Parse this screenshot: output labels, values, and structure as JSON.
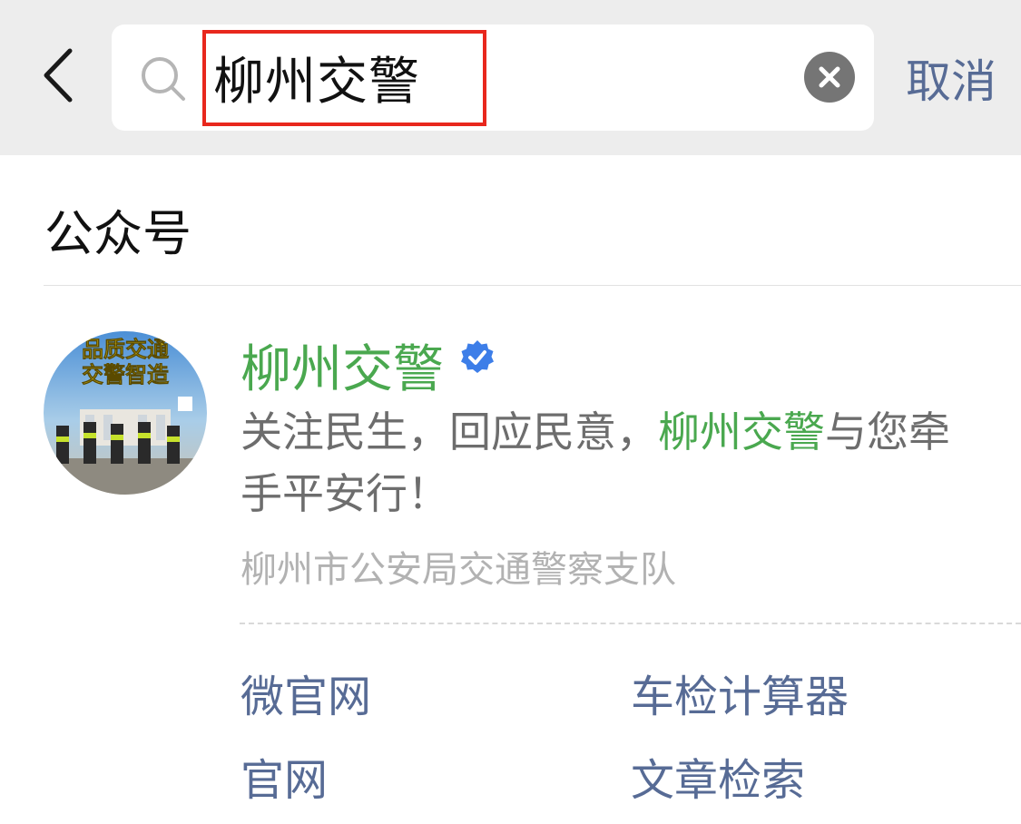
{
  "search": {
    "query": "柳州交警",
    "cancel_label": "取消"
  },
  "section": {
    "title": "公众号"
  },
  "account": {
    "name": "柳州交警",
    "verified": true,
    "description_before": "关注民生，回应民意，",
    "description_highlight": "柳州交警",
    "description_after": "与您牵手平安行！",
    "organization": "柳州市公安局交通警察支队",
    "avatar_text_line1": "品质交通",
    "avatar_text_line2": "交警智造"
  },
  "menu": {
    "items": [
      {
        "label": "微官网"
      },
      {
        "label": "车检计算器"
      },
      {
        "label": "官网"
      },
      {
        "label": "文章检索"
      }
    ]
  },
  "colors": {
    "topbar_bg": "#ededed",
    "link": "#576b95",
    "accent_green": "#4aa84f",
    "highlight_red": "#e8271d",
    "verified_blue": "#3d7ee8"
  }
}
